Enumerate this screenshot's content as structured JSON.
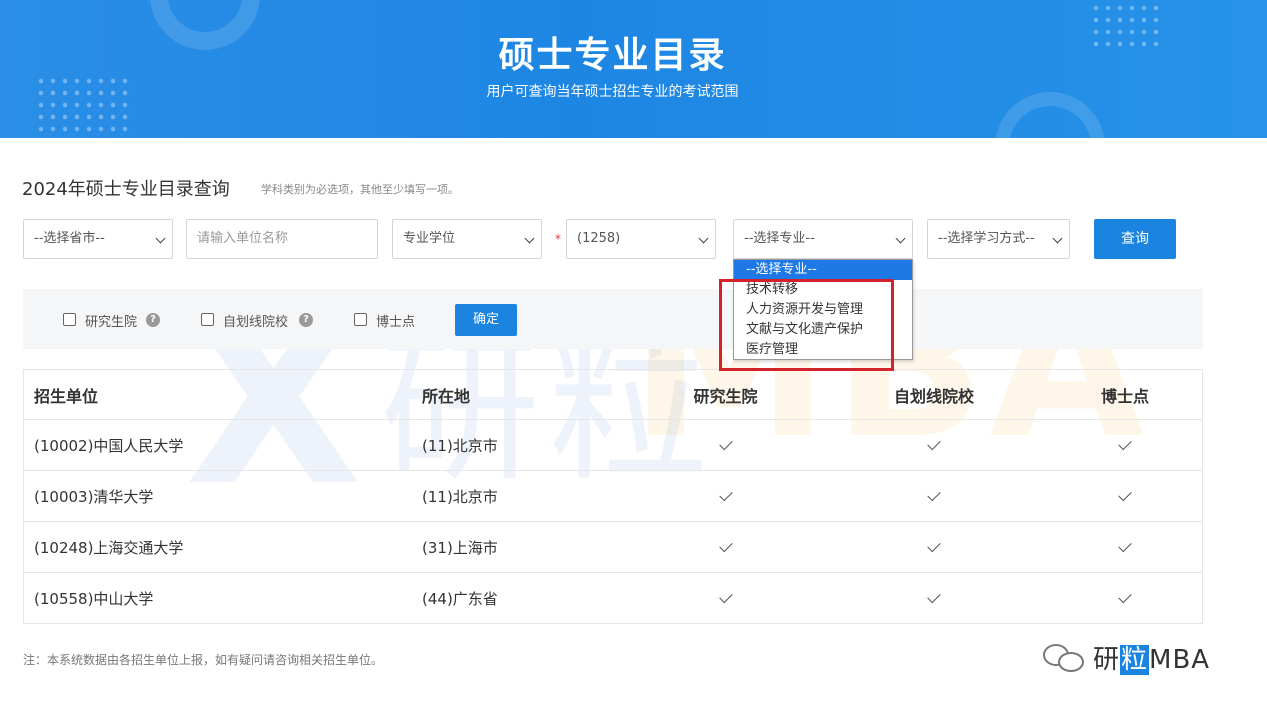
{
  "banner": {
    "title": "硕士专业目录",
    "subtitle": "用户可查询当年硕士招生专业的考试范围"
  },
  "query": {
    "heading": "2024年硕士专业目录查询",
    "hint": "学科类别为必选项，其他至少填写一项。",
    "province_select": "--选择省市--",
    "unit_placeholder": "请输入单位名称",
    "degree_select": "专业学位",
    "required_mark": "*",
    "category_select": "(1258)",
    "major_select": "--选择专业--",
    "study_mode_select": "--选择学习方式--",
    "search_button": "查询"
  },
  "major_dropdown": {
    "options": [
      "--选择专业--",
      "技术转移",
      "人力资源开发与管理",
      "文献与文化遗产保护",
      "医疗管理"
    ],
    "selected_index": 0
  },
  "filters": {
    "graduate_school": "研究生院",
    "self_line": "自划线院校",
    "doctoral": "博士点",
    "help_icon": "?",
    "confirm_button": "确定"
  },
  "table": {
    "headers": [
      "招生单位",
      "所在地",
      "研究生院",
      "自划线院校",
      "博士点"
    ],
    "rows": [
      {
        "unit": "(10002)中国人民大学",
        "location": "(11)北京市",
        "graduate_school": true,
        "self_line": true,
        "doctoral": true
      },
      {
        "unit": "(10003)清华大学",
        "location": "(11)北京市",
        "graduate_school": true,
        "self_line": true,
        "doctoral": true
      },
      {
        "unit": "(10248)上海交通大学",
        "location": "(31)上海市",
        "graduate_school": true,
        "self_line": true,
        "doctoral": true
      },
      {
        "unit": "(10558)中山大学",
        "location": "(44)广东省",
        "graduate_school": true,
        "self_line": true,
        "doctoral": true
      }
    ]
  },
  "footer_note": "注：本系统数据由各招生单位上报，如有疑问请咨询相关招生单位。",
  "brand": {
    "icon": "wechat-icon",
    "text_prefix": "研",
    "text_highlight": "粒",
    "text_suffix": "MBA"
  },
  "watermark": {
    "mark": "X",
    "cn": "研粒",
    "en": "MBA"
  },
  "colors": {
    "primary": "#1a84e0",
    "highlight_box": "#d2222a",
    "required": "#e23b3b"
  }
}
